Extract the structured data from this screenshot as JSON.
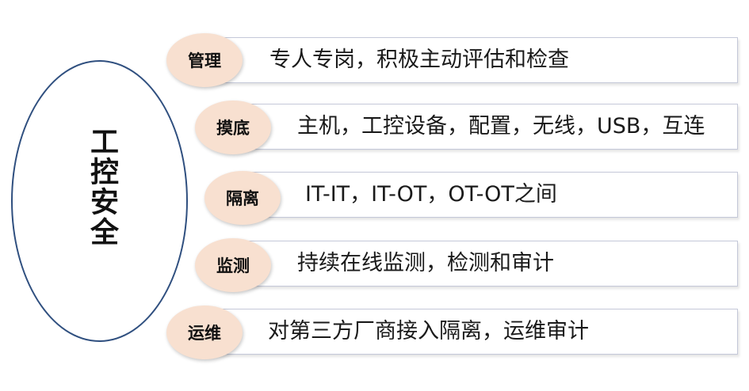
{
  "center": {
    "title": "工控安全"
  },
  "rows": [
    {
      "tag": "管理",
      "text": "专人专岗，积极主动评估和检查"
    },
    {
      "tag": "摸底",
      "text": "主机，工控设备，配置，无线，USB，互连"
    },
    {
      "tag": "隔离",
      "text": "IT-IT，IT-OT，OT-OT之间"
    },
    {
      "tag": "监测",
      "text": "持续在线监测，检测和审计"
    },
    {
      "tag": "运维",
      "text": "对第三方厂商接入隔离，运维审计"
    }
  ],
  "colors": {
    "ellipse_border": "#2f4f7f",
    "pill_fill": "#f8e0d0",
    "box_border": "#c4c8d8"
  }
}
